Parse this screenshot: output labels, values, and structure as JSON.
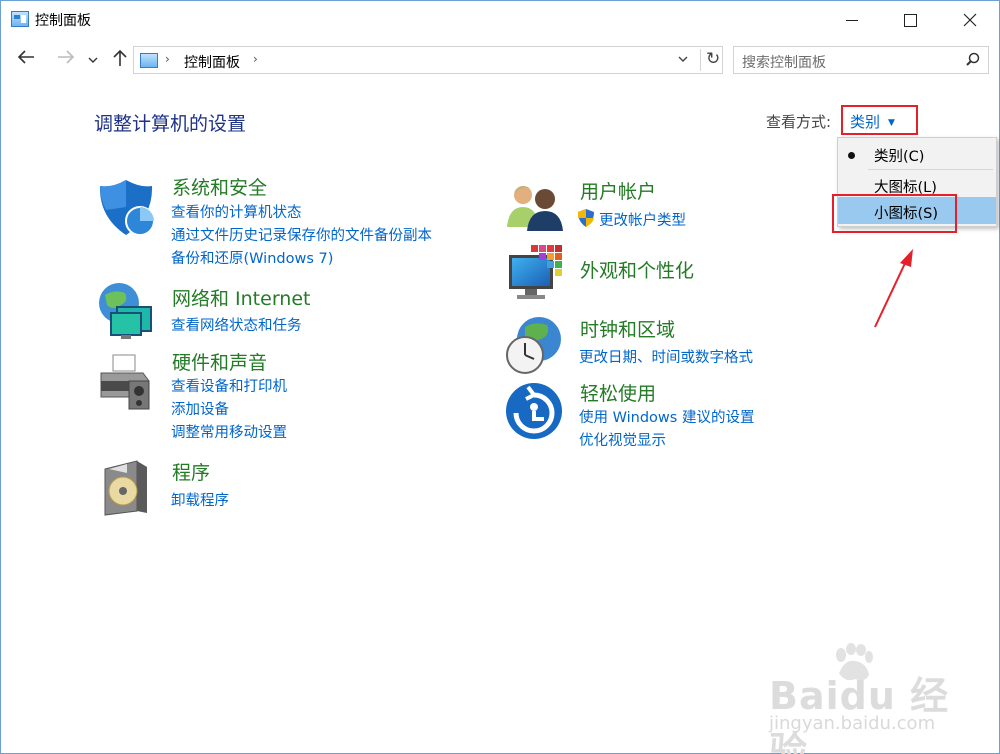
{
  "window": {
    "title": "控制面板"
  },
  "nav": {
    "address": "控制面板",
    "search_placeholder": "搜索控制面板"
  },
  "page": {
    "title": "调整计算机的设置"
  },
  "view": {
    "label": "查看方式:",
    "selected": "类别"
  },
  "dropdown": {
    "options": [
      "类别(C)",
      "大图标(L)",
      "小图标(S)"
    ],
    "checked_index": 0,
    "highlighted_index": 2
  },
  "categories": [
    {
      "title": "系统和安全",
      "icon": "shield-icon",
      "links": [
        "查看你的计算机状态",
        "通过文件历史记录保存你的文件备份副本",
        "备份和还原(Windows 7)"
      ]
    },
    {
      "title": "网络和 Internet",
      "icon": "network-globe-icon",
      "links": [
        "查看网络状态和任务"
      ]
    },
    {
      "title": "硬件和声音",
      "icon": "printer-icon",
      "links": [
        "查看设备和打印机",
        "添加设备",
        "调整常用移动设置"
      ]
    },
    {
      "title": "程序",
      "icon": "programs-disc-icon",
      "links": [
        "卸载程序"
      ]
    },
    {
      "title": "用户帐户",
      "icon": "users-icon",
      "links": [
        "更改帐户类型"
      ]
    },
    {
      "title": "外观和个性化",
      "icon": "monitor-palette-icon",
      "links": []
    },
    {
      "title": "时钟和区域",
      "icon": "clock-globe-icon",
      "links": [
        "更改日期、时间或数字格式"
      ]
    },
    {
      "title": "轻松使用",
      "icon": "ease-of-access-icon",
      "links": [
        "使用 Windows 建议的设置",
        "优化视觉显示"
      ]
    }
  ],
  "watermark": {
    "line1": "Baidu 经验",
    "line2": "jingyan.baidu.com"
  },
  "colors": {
    "category_title": "#247b26",
    "link": "#0066cc",
    "page_title": "#1e3287",
    "annotation_red": "#e5202b",
    "highlight": "#99c9ef"
  }
}
